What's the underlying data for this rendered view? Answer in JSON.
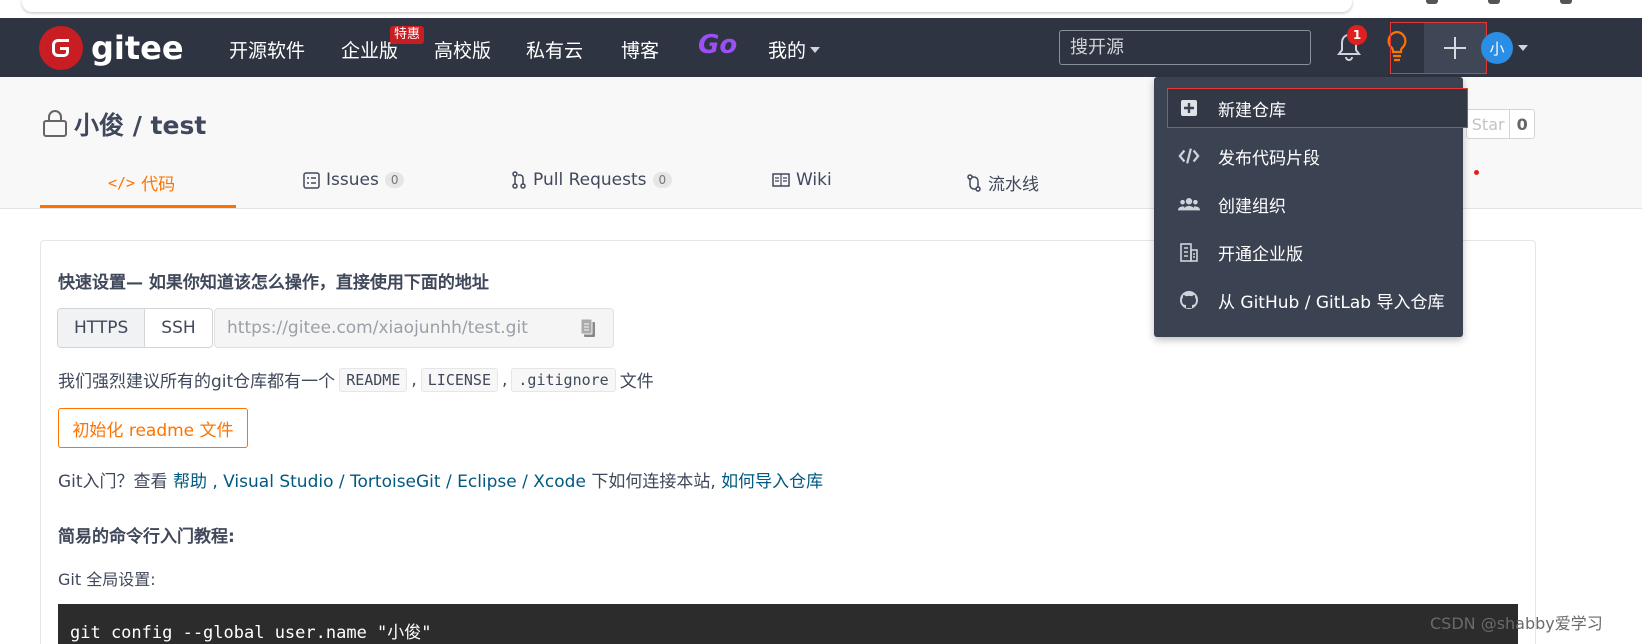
{
  "header": {
    "logo_text": "gitee",
    "nav": [
      "开源软件",
      "企业版",
      "高校版",
      "私有云",
      "博客"
    ],
    "nav_badge": "特惠",
    "nav_go": "Go",
    "nav_mine": "我的",
    "search_placeholder": "搜开源",
    "notification_count": "1",
    "avatar_text": "小"
  },
  "repo": {
    "title": "小俊 / test",
    "star_label": "Star",
    "star_count": "0"
  },
  "tabs": [
    {
      "label": "代码",
      "icon": "code-icon"
    },
    {
      "label": "Issues",
      "count": "0",
      "icon": "issues-icon"
    },
    {
      "label": "Pull Requests",
      "count": "0",
      "icon": "pull-request-icon"
    },
    {
      "label": "Wiki",
      "icon": "wiki-icon"
    },
    {
      "label": "流水线",
      "icon": "pipeline-icon"
    }
  ],
  "quick_setup": {
    "title": "快速设置— 如果你知道该怎么操作，直接使用下面的地址",
    "protocols": [
      "HTTPS",
      "SSH"
    ],
    "url": "https://gitee.com/xiaojunhh/test.git",
    "advise_prefix": "我们强烈建议所有的git仓库都有一个",
    "files": [
      "README",
      "LICENSE",
      ".gitignore"
    ],
    "sep": ",",
    "advise_suffix": "文件",
    "init_button": "初始化 readme 文件",
    "intro_prefix": "Git入门？查看 ",
    "link_help": "帮助",
    "intro_tools": " , Visual Studio / TortoiseGit / Eclipse / Xcode",
    "intro_mid": " 下如何连接本站, ",
    "link_import": "如何导入仓库",
    "cmd_title": "简易的命令行入门教程:",
    "global_setting": "Git 全局设置:",
    "code_line": "git config --global user.name \"小俊\""
  },
  "dropdown": {
    "items": [
      {
        "label": "新建仓库",
        "icon": "plus-square-icon"
      },
      {
        "label": "发布代码片段",
        "icon": "code-icon"
      },
      {
        "label": "创建组织",
        "icon": "users-icon"
      },
      {
        "label": "开通企业版",
        "icon": "building-icon"
      },
      {
        "label": "从 GitHub / GitLab 导入仓库",
        "icon": "github-icon"
      }
    ]
  },
  "watermark": "CSDN @shabby爱学习",
  "colors": {
    "header_bg": "#2e3441",
    "accent": "#fe7300",
    "brand_red": "#c71d23",
    "dropdown_bg": "#3b4252",
    "highlight_border": "#e53935"
  }
}
